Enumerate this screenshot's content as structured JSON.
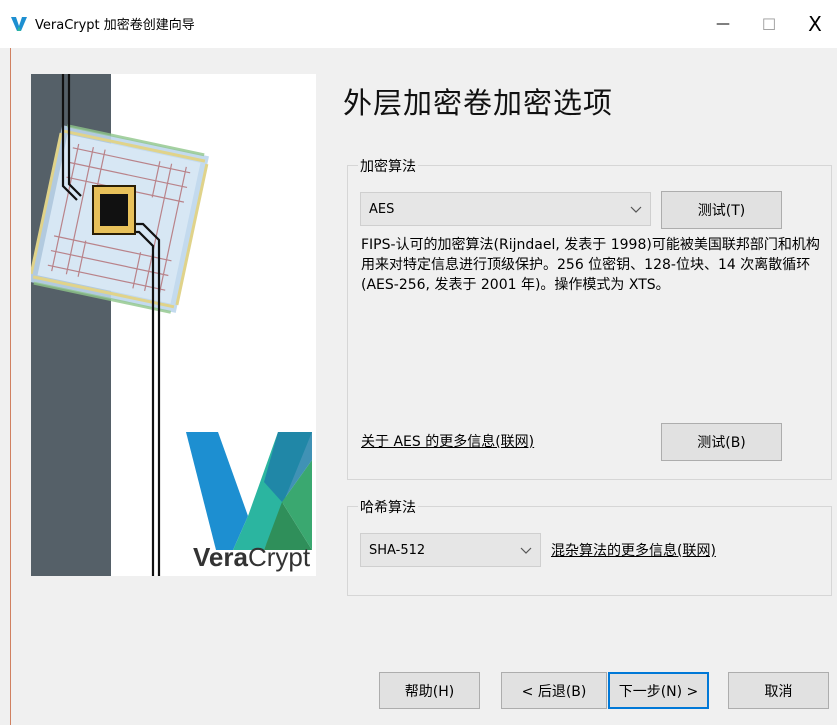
{
  "window": {
    "title": "VeraCrypt 加密卷创建向导",
    "minimize_symbol": "—",
    "maximize_symbol": "☐",
    "close_symbol": "X"
  },
  "sidebar": {
    "brand_bold": "Vera",
    "brand_light": "Crypt"
  },
  "page": {
    "title": "外层加密卷加密选项"
  },
  "encryption": {
    "group_label": "加密算法",
    "selected": "AES",
    "test_button": "测试(T)",
    "description": "FIPS-认可的加密算法(Rijndael, 发表于 1998)可能被美国联邦部门和机构用来对特定信息进行顶级保护。256 位密钥、128-位块、14 次离散循环(AES-256, 发表于 2001 年)。操作模式为 XTS。",
    "more_info_link": "关于 AES 的更多信息(联网)",
    "benchmark_button": "测试(B)"
  },
  "hash": {
    "group_label": "哈希算法",
    "selected": "SHA-512",
    "more_info_link": "混杂算法的更多信息(联网)"
  },
  "footer": {
    "help": "帮助(H)",
    "back": "< 后退(B)",
    "next": "下一步(N) >",
    "cancel": "取消"
  },
  "colors": {
    "accent": "#0078d7",
    "brand_blue": "#1d8fd1",
    "brand_teal": "#2bb5a0",
    "brand_green": "#2f8f5a",
    "slate": "#556068"
  },
  "icons": {
    "app": "veracrypt-logo-icon",
    "combo_arrow": "chevron-down-icon"
  }
}
